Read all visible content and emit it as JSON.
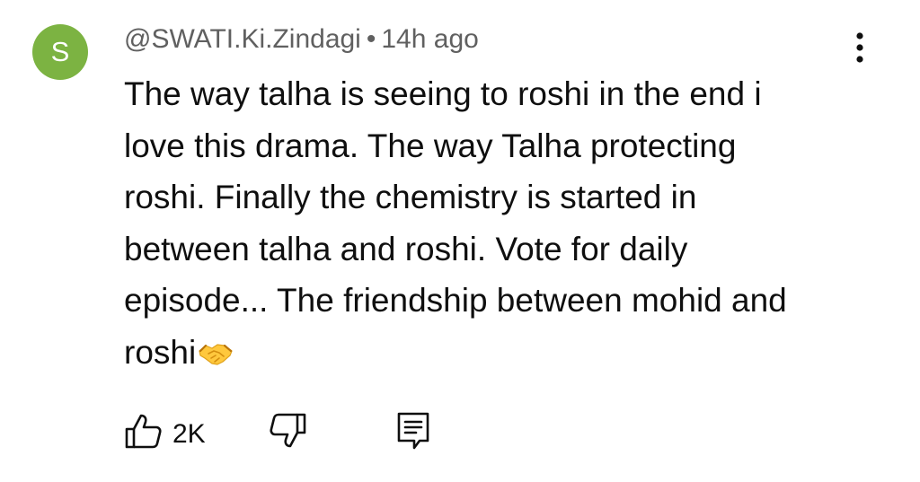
{
  "comment": {
    "avatar_letter": "S",
    "avatar_color": "#7cb342",
    "author": "@SWATI.Ki.Zindagi",
    "separator": "•",
    "time": "14h ago",
    "text_lines": [
      "The way talha is seeing to roshi in the end i",
      "love this drama. The way Talha protecting",
      "roshi. Finally the chemistry is started in",
      "between talha and roshi. Vote for daily",
      "episode... The friendship between mohid and",
      "roshi"
    ],
    "emoji_icon": "handshake-icon"
  },
  "actions": {
    "like_icon": "thumbs-up-icon",
    "like_count": "2K",
    "dislike_icon": "thumbs-down-icon",
    "reply_icon": "reply-comment-icon",
    "menu_icon": "more-vertical-icon"
  }
}
